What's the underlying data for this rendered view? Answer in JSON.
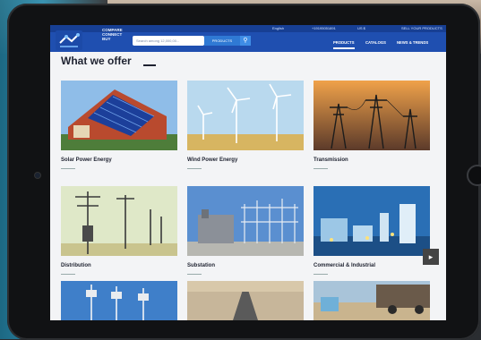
{
  "header": {
    "logo_line1": "COMPARE",
    "logo_line2": "CONNECT",
    "logo_line3": "BUY",
    "language": "English",
    "phone": "+19195051891",
    "currency": "US $",
    "sell_link": "SELL YOUR PRODUCTS",
    "search_placeholder": "Search among 12,000,00...",
    "search_category": "PRODUCTS",
    "nav": [
      "PRODUCTS",
      "CATALOGS",
      "NEWS & TRENDS"
    ]
  },
  "section": {
    "title": "What we offer"
  },
  "cards": [
    {
      "label": "Solar Power Energy"
    },
    {
      "label": "Wind Power Energy"
    },
    {
      "label": "Transmission"
    },
    {
      "label": "Distribution"
    },
    {
      "label": "Substation"
    },
    {
      "label": "Commercial & Industrial"
    }
  ],
  "colors": {
    "header": "#1f4fb0",
    "accent": "#2f79d4"
  }
}
